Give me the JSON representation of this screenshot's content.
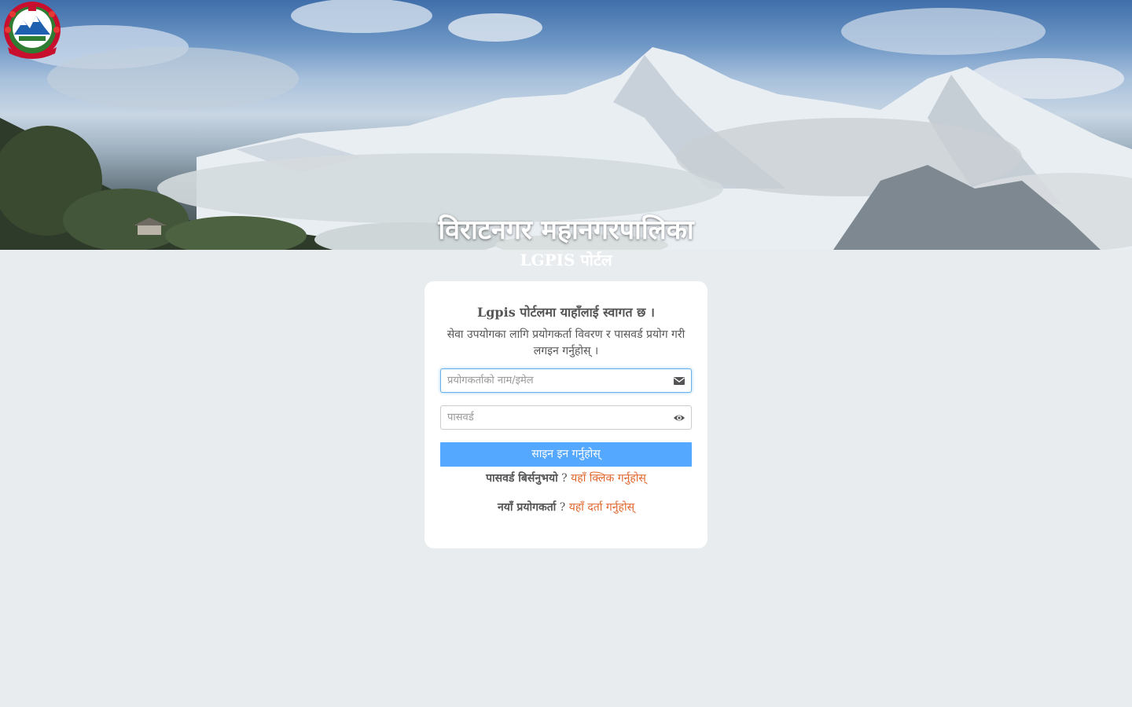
{
  "header": {
    "city_title": "विराटनगर महानगरपालिका",
    "portal_title": "LGPIS पोर्टल"
  },
  "login": {
    "welcome": "Lgpis पोर्टलमा याहाँलाई स्वागत छ ।",
    "subtitle": "सेवा उपयोगका लागि प्रयोगकर्ता विवरण र पासवर्ड प्रयोग गरी लगइन गर्नुहोस् ।",
    "username_placeholder": "प्रयोगकर्ताको नाम/इमेल",
    "username_value": "",
    "password_placeholder": "पासवर्ड",
    "password_value": "",
    "signin_label": "साइन इन गर्नुहोस्",
    "forgot_label": "पासवर्ड बिर्सनुभयो",
    "forgot_q": "?",
    "forgot_link": "यहाँ क्लिक गर्नुहोस्",
    "new_user_label": "नयाँ प्रयोगकर्ता",
    "new_user_q": "?",
    "new_user_link": "यहाँ दर्ता गर्नुहोस्"
  },
  "icons": {
    "username_field": "envelope-icon",
    "password_field": "eye-icon",
    "emblem": "nepal-emblem"
  },
  "colors": {
    "page_bg": "#e8ecee",
    "signin_button": "#55a8ff",
    "link": "#e0662c",
    "text": "#555555"
  }
}
